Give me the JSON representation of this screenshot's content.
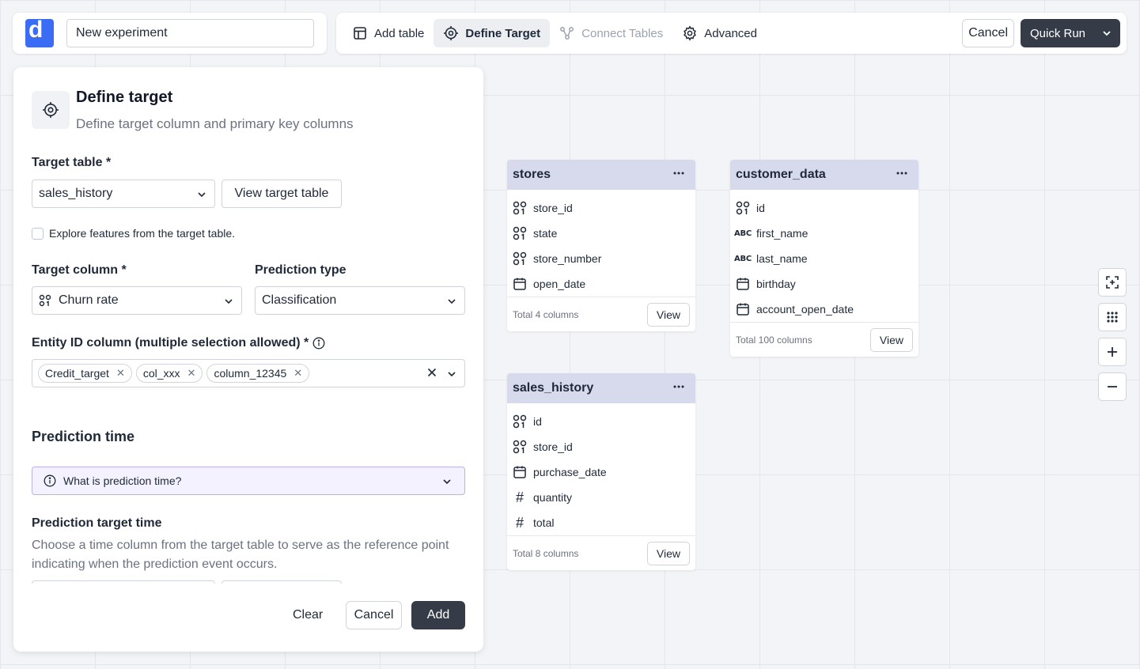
{
  "header": {
    "logo_letter": "d",
    "experiment_name": "New experiment"
  },
  "toolbar": {
    "add_table": "Add table",
    "define_target": "Define Target",
    "connect_tables": "Connect Tables",
    "advanced": "Advanced",
    "cancel": "Cancel",
    "quick_run": "Quick Run"
  },
  "panel": {
    "title": "Define target",
    "subtitle": "Define target column and primary key columns",
    "target_table_label": "Target table *",
    "target_table_value": "sales_history",
    "view_target_table": "View target table",
    "explore_checkbox": "Explore features from the target table.",
    "target_column_label": "Target column *",
    "target_column_value": "Churn rate",
    "prediction_type_label": "Prediction type",
    "prediction_type_value": "Classification",
    "entity_id_label": "Entity ID column (multiple selection allowed) *",
    "entity_chips": [
      "Credit_target",
      "col_xxx",
      "column_12345"
    ],
    "prediction_time_heading": "Prediction time",
    "prediction_time_info": "What is prediction time?",
    "prediction_target_time_heading": "Prediction target time",
    "prediction_target_time_desc": "Choose a time column from the target table to serve as the reference point indicating when the prediction event occurs.",
    "btn_clear": "Clear",
    "btn_cancel": "Cancel",
    "btn_add": "Add"
  },
  "tables": {
    "stores": {
      "name": "stores",
      "columns": [
        {
          "name": "store_id",
          "type": "id"
        },
        {
          "name": "state",
          "type": "id"
        },
        {
          "name": "store_number",
          "type": "id"
        },
        {
          "name": "open_date",
          "type": "date"
        }
      ],
      "total": "Total 4 columns",
      "view": "View"
    },
    "customer_data": {
      "name": "customer_data",
      "columns": [
        {
          "name": "id",
          "type": "id"
        },
        {
          "name": "first_name",
          "type": "text"
        },
        {
          "name": "last_name",
          "type": "text"
        },
        {
          "name": "birthday",
          "type": "date"
        },
        {
          "name": "account_open_date",
          "type": "date"
        }
      ],
      "total": "Total 100 columns",
      "view": "View"
    },
    "sales_history": {
      "name": "sales_history",
      "columns": [
        {
          "name": "id",
          "type": "id"
        },
        {
          "name": "store_id",
          "type": "id"
        },
        {
          "name": "purchase_date",
          "type": "date"
        },
        {
          "name": "quantity",
          "type": "number"
        },
        {
          "name": "total",
          "type": "number"
        }
      ],
      "total": "Total 8 columns",
      "view": "View"
    }
  },
  "type_badges": {
    "text": "ABC",
    "number": "#"
  },
  "colors": {
    "primary_dark": "#353c48",
    "logo_blue": "#3b6cf6",
    "table_header": "#d7d9ec",
    "info_bg": "#f4f2fe"
  }
}
